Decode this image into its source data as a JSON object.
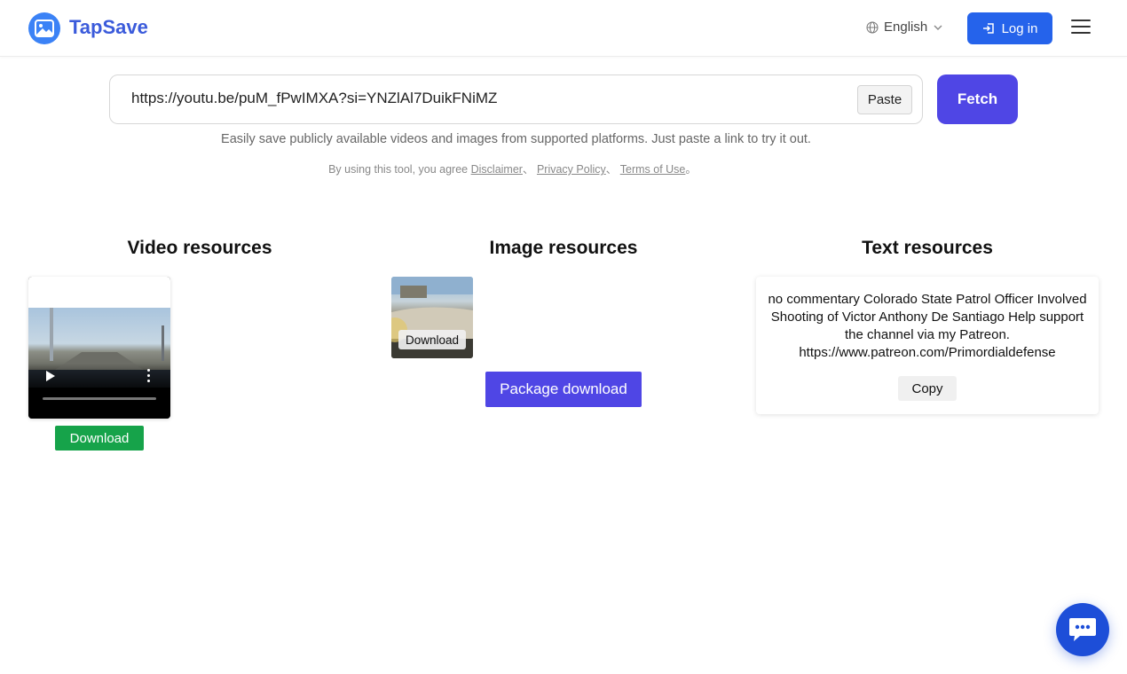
{
  "header": {
    "brand": "TapSave",
    "language": "English",
    "login_label": "Log in"
  },
  "search": {
    "value": "https://youtu.be/puM_fPwIMXA?si=YNZlAl7DuikFNiMZ",
    "paste_label": "Paste",
    "fetch_label": "Fetch",
    "tagline": "Easily save publicly available videos and images from supported platforms. Just paste a link to try it out.",
    "terms_prefix": "By using this tool, you agree",
    "disclaimer": "Disclaimer",
    "sep1": "、",
    "privacy": "Privacy Policy",
    "sep2": "、",
    "terms": "Terms of Use",
    "terms_end": "。"
  },
  "sections": {
    "video_title": "Video resources",
    "image_title": "Image resources",
    "text_title": "Text resources"
  },
  "video": {
    "download_label": "Download"
  },
  "image": {
    "download_label": "Download",
    "package_label": "Package download"
  },
  "text": {
    "content": "no commentary Colorado State Patrol Officer Involved Shooting of Victor Anthony De Santiago Help support the channel via my Patreon. https://www.patreon.com/Primordialdefense",
    "copy_label": "Copy"
  },
  "colors": {
    "primary": "#4f46e5",
    "login": "#2563eb",
    "download_green": "#16a34a",
    "brand": "#3b5bdb"
  }
}
